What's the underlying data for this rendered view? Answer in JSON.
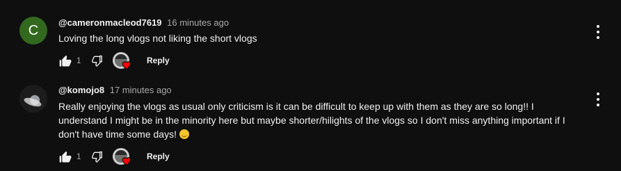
{
  "comments": [
    {
      "avatar_letter": "C",
      "avatar_color": "#33691e",
      "author": "@cameronmacleod7619",
      "time": "16 minutes ago",
      "text": "Loving the long vlogs not liking the short vlogs",
      "like_count": "1",
      "reply_label": "Reply"
    },
    {
      "author": "@komojo8",
      "time": "17 minutes ago",
      "text": "Really enjoying the vlogs as usual only criticism is it can be difficult to keep up with them as they are so long!! I understand I might be in the minority here but maybe shorter/hilights of the vlogs so I don't miss anything important if I don't have time some days!",
      "emoji": "slightly-smiling-face",
      "like_count": "1",
      "reply_label": "Reply"
    }
  ],
  "icons": {
    "like": "thumbs-up-icon",
    "dislike": "thumbs-down-icon",
    "heart": "creator-heart-icon",
    "menu": "more-vert-icon"
  },
  "colors": {
    "background": "#0f0f0f",
    "text": "#f1f1f1",
    "secondary_text": "#aaaaaa",
    "heart": "#ff0000"
  }
}
